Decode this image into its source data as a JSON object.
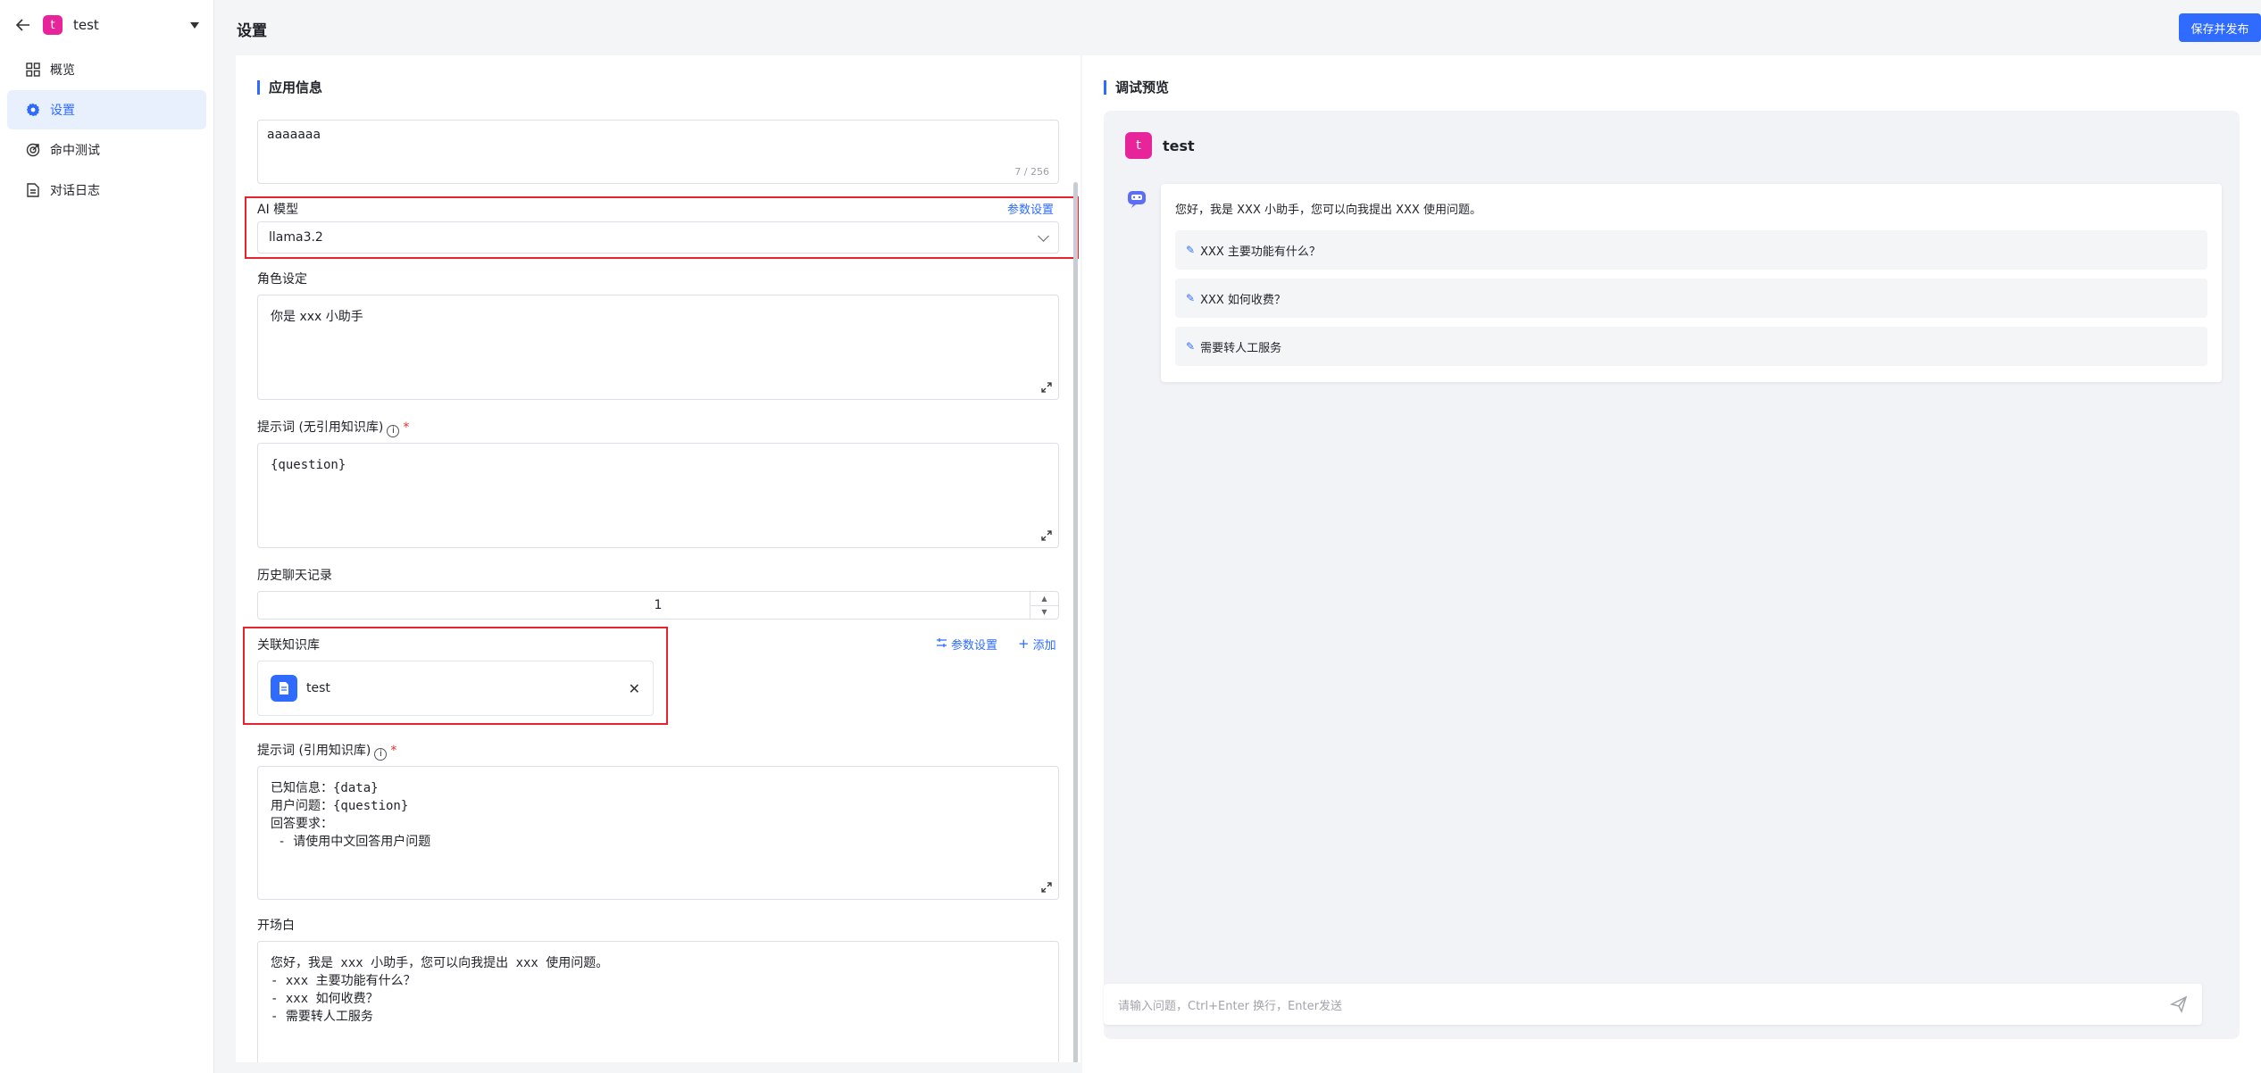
{
  "app": {
    "avatar_letter": "t",
    "name": "test",
    "avatar_color": "#e8249a"
  },
  "nav": [
    {
      "label": "概览",
      "icon": "grid-icon",
      "active": false
    },
    {
      "label": "设置",
      "icon": "gear-icon",
      "active": true
    },
    {
      "label": "命中测试",
      "icon": "target-icon",
      "active": false
    },
    {
      "label": "对话日志",
      "icon": "document-icon",
      "active": false
    }
  ],
  "header": {
    "title": "设置",
    "publish_label": "保存并发布"
  },
  "settings": {
    "section_title": "应用信息",
    "description": {
      "value": "aaaaaaa",
      "counter": "7 / 256"
    },
    "ai_model": {
      "label": "AI 模型",
      "param_link": "参数设置",
      "value": "llama3.2"
    },
    "role": {
      "label": "角色设定",
      "value": "你是 xxx 小助手"
    },
    "prompt_no_kb": {
      "label": "提示词 (无引用知识库)",
      "info": "i",
      "required": "*",
      "value": "{question}"
    },
    "history": {
      "label": "历史聊天记录",
      "value": "1"
    },
    "kb": {
      "label": "关联知识库",
      "param_link": "参数设置",
      "add_link": "添加",
      "item_name": "test"
    },
    "prompt_kb": {
      "label": "提示词 (引用知识库)",
      "info": "i",
      "required": "*",
      "value": "已知信息：{data}\n用户问题：{question}\n回答要求：\n - 请使用中文回答用户问题"
    },
    "opening": {
      "label": "开场白",
      "value": "您好，我是 xxx 小助手，您可以向我提出 xxx 使用问题。\n- xxx 主要功能有什么？\n- xxx 如何收费？\n- 需要转人工服务"
    }
  },
  "preview": {
    "section_title": "调试预览",
    "bot_avatar_letter": "t",
    "bot_name": "test",
    "greeting": "您好，我是 XXX 小助手，您可以向我提出 XXX 使用问题。",
    "suggestions": [
      "XXX 主要功能有什么？",
      "XXX 如何收费？",
      "需要转人工服务"
    ],
    "input_placeholder": "请输入问题，Ctrl+Enter 换行，Enter发送"
  },
  "colors": {
    "accent": "#2f6bff",
    "highlight_box": "#e5232c"
  }
}
